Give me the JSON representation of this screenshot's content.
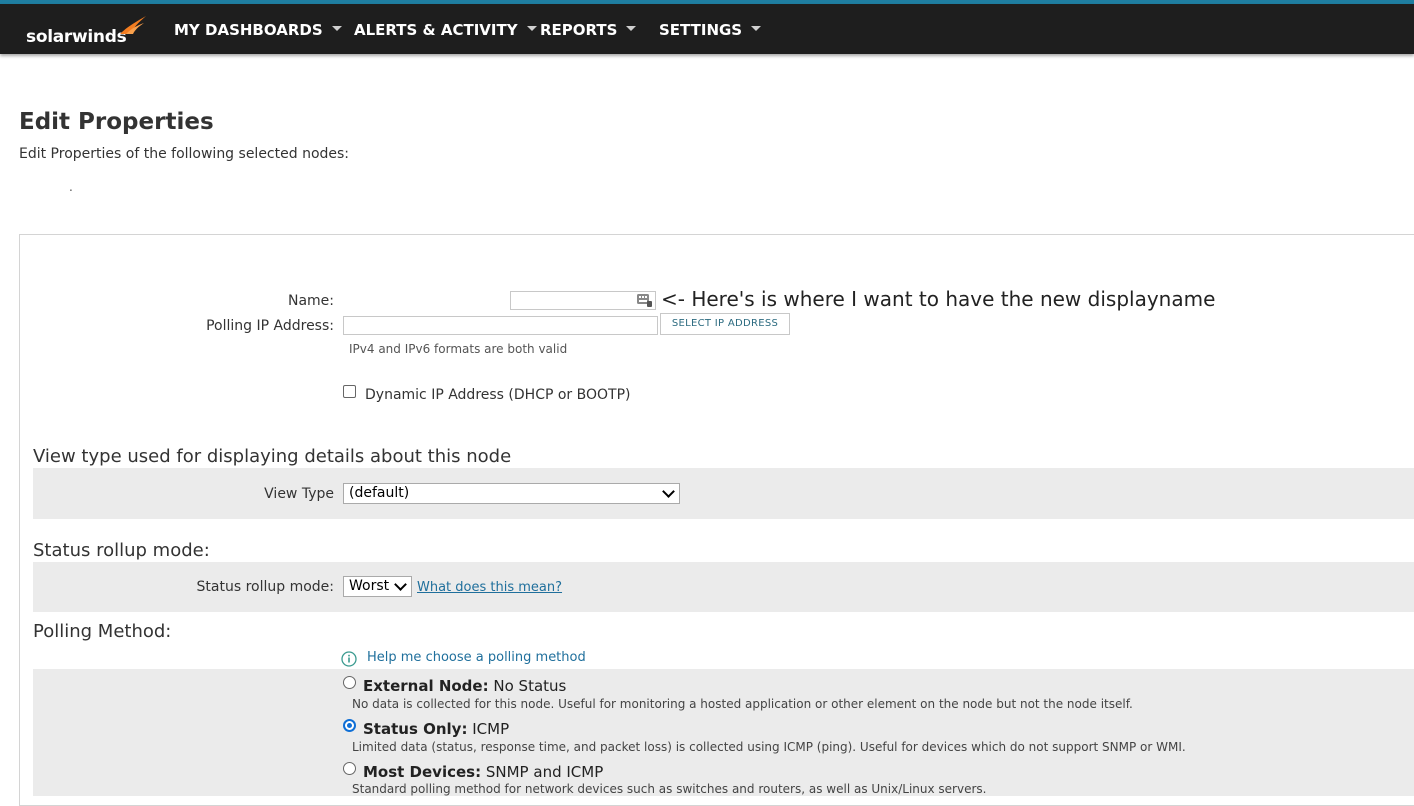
{
  "brand": {
    "name": "solarwinds",
    "accent": "#f47d20",
    "top_line": "#1f7ea1",
    "nav_bg": "#1e1e1e"
  },
  "nav": {
    "items": [
      {
        "label": "MY DASHBOARDS"
      },
      {
        "label": "ALERTS & ACTIVITY"
      },
      {
        "label": "REPORTS"
      },
      {
        "label": "SETTINGS"
      }
    ]
  },
  "page": {
    "title": "Edit Properties",
    "subtitle": "Edit Properties of the following selected nodes:",
    "node_list_stub": "."
  },
  "form": {
    "name_label": "Name:",
    "name_value": "",
    "annotation": "<- Here's is where I want to have the new displayname",
    "ip_label": "Polling IP Address:",
    "ip_value": "",
    "select_ip_button": "SELECT IP ADDRESS",
    "ip_hint": "IPv4 and IPv6 formats are both valid",
    "dynamic_ip_label": "Dynamic IP Address (DHCP or BOOTP)",
    "dynamic_ip_checked": false
  },
  "view_type": {
    "heading": "View type used for displaying details about this node",
    "label": "View Type",
    "selected": "(default)"
  },
  "rollup": {
    "heading": "Status rollup mode:",
    "label": "Status rollup mode:",
    "selected": "Worst",
    "help_link": "What does this mean?"
  },
  "polling": {
    "heading": "Polling Method:",
    "help_link": "Help me choose a polling method",
    "options": [
      {
        "title": "External Node:",
        "suffix": "No Status",
        "desc": "No data is collected for this node. Useful for monitoring a hosted application or other element on the node but not the node itself.",
        "selected": false
      },
      {
        "title": "Status Only:",
        "suffix": "ICMP",
        "desc": "Limited data (status, response time, and packet loss) is collected using ICMP (ping). Useful for devices which do not support SNMP or WMI.",
        "selected": true
      },
      {
        "title": "Most Devices:",
        "suffix": "SNMP and ICMP",
        "desc": "Standard polling method for network devices such as switches and routers, as well as Unix/Linux servers.",
        "selected": false
      }
    ]
  }
}
